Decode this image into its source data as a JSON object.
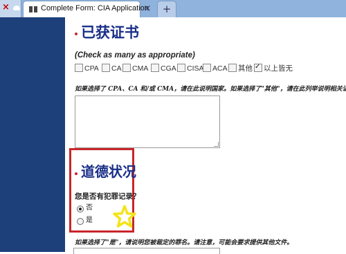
{
  "browser": {
    "active_tab_title": "Complete Form: CIA Application",
    "close_glyph": "×",
    "new_tab_glyph": "+",
    "prev_tab_close_glyph": "×"
  },
  "certificates": {
    "title": "已获证书",
    "hint": "(Check as many as appropriate)",
    "options": [
      {
        "label": "CPA",
        "checked": false
      },
      {
        "label": "CA",
        "checked": false
      },
      {
        "label": "CMA",
        "checked": false
      },
      {
        "label": "CGA",
        "checked": false
      },
      {
        "label": "CISA",
        "checked": false
      },
      {
        "label": "ACA",
        "checked": false
      },
      {
        "label": "其他",
        "checked": false
      },
      {
        "label": "以上皆无",
        "checked": true
      }
    ],
    "note": "如果选择了 CPA、CA 和/或 CMA，请在此说明国家。如果选择了\"其他\"，请在此列举说明相关证书。"
  },
  "ethics": {
    "title": "道德状况",
    "question": "您是否有犯罪记录？",
    "options": [
      {
        "label": "否",
        "selected": true
      },
      {
        "label": "是",
        "selected": false
      }
    ],
    "note": "如果选择了\"是\"，请说明您被裁定的罪名。请注意，可能会要求提供其他文件。"
  },
  "colors": {
    "sidebar": "#1d3f7a",
    "title": "#1a2f88",
    "highlight_border": "#c9252b",
    "star": "#f5e31a"
  }
}
